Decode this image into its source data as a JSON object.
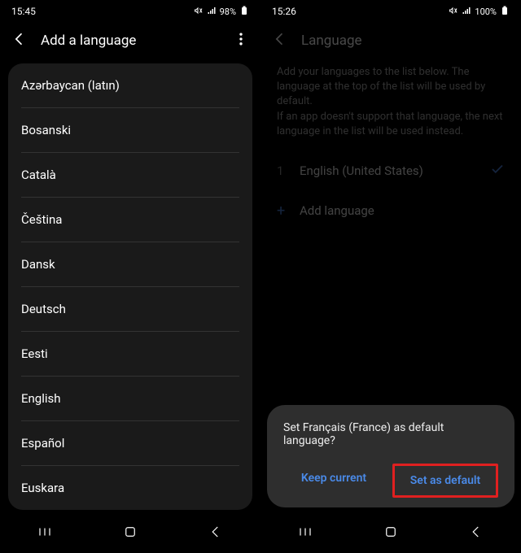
{
  "left": {
    "status": {
      "time": "15:45",
      "battery": "98%"
    },
    "header": {
      "title": "Add a language"
    },
    "languages": [
      "Azərbaycan (latın)",
      "Bosanski",
      "Català",
      "Čeština",
      "Dansk",
      "Deutsch",
      "Eesti",
      "English",
      "Español",
      "Euskara"
    ]
  },
  "right": {
    "status": {
      "time": "15:26",
      "battery": "100%"
    },
    "header": {
      "title": "Language"
    },
    "info_line1": "Add your languages to the list below. The language at the top of the list will be used by default.",
    "info_line2": "If an app doesn't support that language, the next language in the list will be used instead.",
    "rows": {
      "index": "1",
      "selected": "English (United States)",
      "add": "Add language"
    },
    "dialog": {
      "message": "Set Français (France) as default language?",
      "keep": "Keep current",
      "setdefault": "Set as default"
    }
  }
}
